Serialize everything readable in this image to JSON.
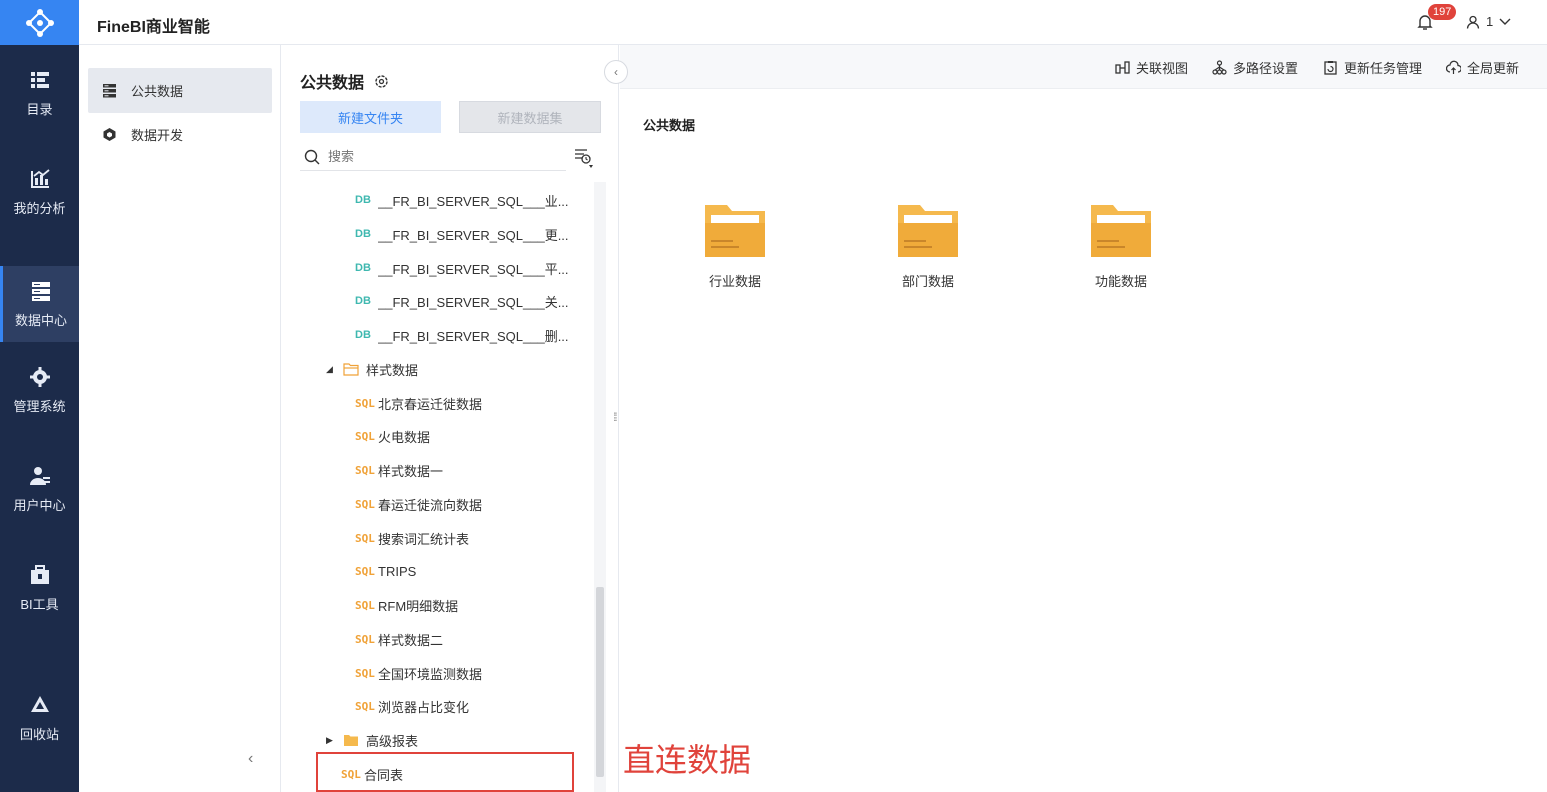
{
  "header": {
    "app_title": "FineBI商业智能",
    "notification_count": "197",
    "user_name": "1"
  },
  "nav": {
    "items": [
      {
        "label": "目录",
        "icon": "catalog-icon"
      },
      {
        "label": "我的分析",
        "icon": "analysis-icon"
      },
      {
        "label": "数据中心",
        "icon": "data-center-icon",
        "active": true
      },
      {
        "label": "管理系统",
        "icon": "gear-icon"
      },
      {
        "label": "用户中心",
        "icon": "user-icon"
      },
      {
        "label": "BI工具",
        "icon": "toolbox-icon"
      },
      {
        "label": "回收站",
        "icon": "recycle-icon"
      }
    ]
  },
  "submenu": {
    "items": [
      {
        "label": "公共数据",
        "active": true
      },
      {
        "label": "数据开发"
      }
    ]
  },
  "tree_panel": {
    "title": "公共数据",
    "new_folder_label": "新建文件夹",
    "new_dataset_label": "新建数据集",
    "search_placeholder": "搜索",
    "rows": [
      {
        "type": "db",
        "label": "__FR_BI_SERVER_SQL___业..."
      },
      {
        "type": "db",
        "label": "__FR_BI_SERVER_SQL___更..."
      },
      {
        "type": "db",
        "label": "__FR_BI_SERVER_SQL___平..."
      },
      {
        "type": "db",
        "label": "__FR_BI_SERVER_SQL___关..."
      },
      {
        "type": "db",
        "label": "__FR_BI_SERVER_SQL___删..."
      },
      {
        "type": "folder-open",
        "label": "样式数据"
      },
      {
        "type": "sql",
        "label": "北京春运迁徙数据"
      },
      {
        "type": "sql",
        "label": "火电数据"
      },
      {
        "type": "sql",
        "label": "样式数据一"
      },
      {
        "type": "sql",
        "label": "春运迁徙流向数据"
      },
      {
        "type": "sql",
        "label": "搜索词汇统计表"
      },
      {
        "type": "sql",
        "label": "TRIPS"
      },
      {
        "type": "sql",
        "label": "RFM明细数据"
      },
      {
        "type": "sql",
        "label": "样式数据二"
      },
      {
        "type": "sql",
        "label": "全国环境监测数据"
      },
      {
        "type": "sql",
        "label": "浏览器占比变化"
      },
      {
        "type": "folder-closed",
        "label": "高级报表"
      },
      {
        "type": "sql",
        "label": "合同表"
      }
    ]
  },
  "toolbar": {
    "relation_view": "关联视图",
    "multipath_settings": "多路径设置",
    "update_task_management": "更新任务管理",
    "global_update": "全局更新"
  },
  "main": {
    "title": "公共数据",
    "folders": [
      "行业数据",
      "部门数据",
      "功能数据"
    ]
  },
  "annotation": "直连数据",
  "colors": {
    "accent": "#3685f2",
    "nav_bg": "#1c2b4a",
    "folder": "#f5b94d",
    "highlight": "#e0433b"
  }
}
